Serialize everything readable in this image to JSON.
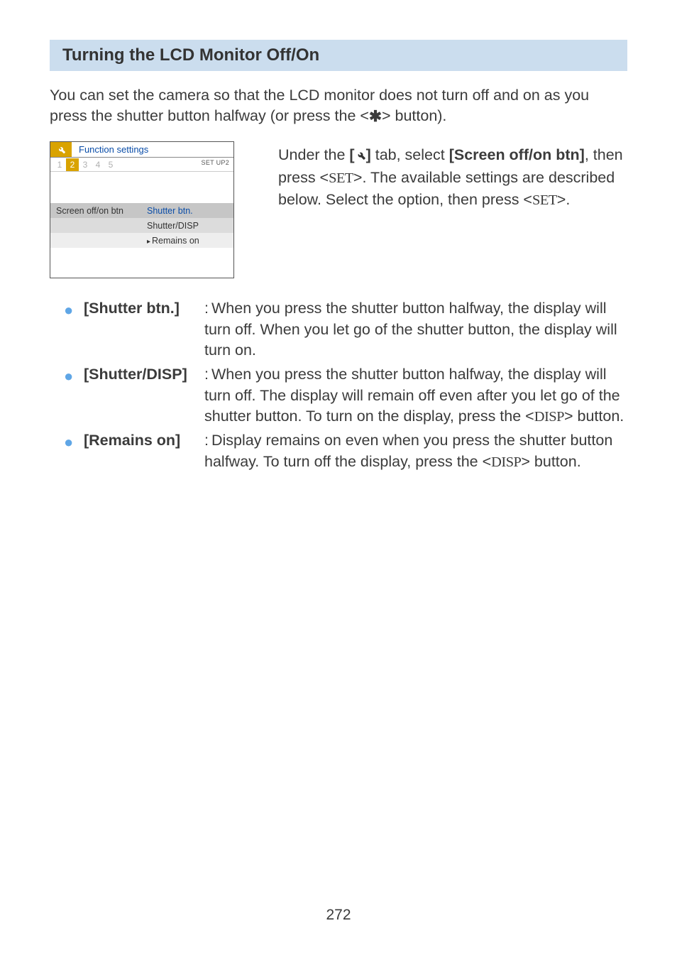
{
  "section_title": "Turning the LCD Monitor Off/On",
  "intro_pre": "You can set the camera so that the LCD monitor does not turn off and on as you press the shutter button halfway (or press the <",
  "intro_star": "✱",
  "intro_post": "> button).",
  "camera": {
    "title": "Function settings",
    "tabs": [
      "1",
      "2",
      "3",
      "4",
      "5"
    ],
    "setup_label": "SET UP2",
    "menu_label": "Screen off/on btn",
    "opt1": "Shutter btn.",
    "opt2": "Shutter/DISP",
    "opt3": "Remains on"
  },
  "side": {
    "l1a": "Under the ",
    "l1b": "[",
    "l1_icon": "🔧",
    "l1c": "]",
    "l1d": " tab, select ",
    "l1e": "[Screen off/on btn]",
    "l1f": ", then press <",
    "set": "SET",
    "l1g": ">. The available settings are described below. Select the option, then press <",
    "l1h": ">."
  },
  "options": [
    {
      "term": "[Shutter btn.]",
      "def": "When you press the shutter button halfway, the display will turn off. When you let go of the shutter button, the display will turn on."
    },
    {
      "term": "[Shutter/DISP]",
      "def_a": "When you press the shutter button halfway, the display will turn off. The display will remain off even after you let go of the shutter button. To turn on the display, press the <",
      "disp": "DISP",
      "def_b": "> button."
    },
    {
      "term": "[Remains on]",
      "def_a": "Display remains on even when you press the shutter button halfway. To turn off the display, press the <",
      "disp": "DISP",
      "def_b": "> button."
    }
  ],
  "page_number": "272"
}
